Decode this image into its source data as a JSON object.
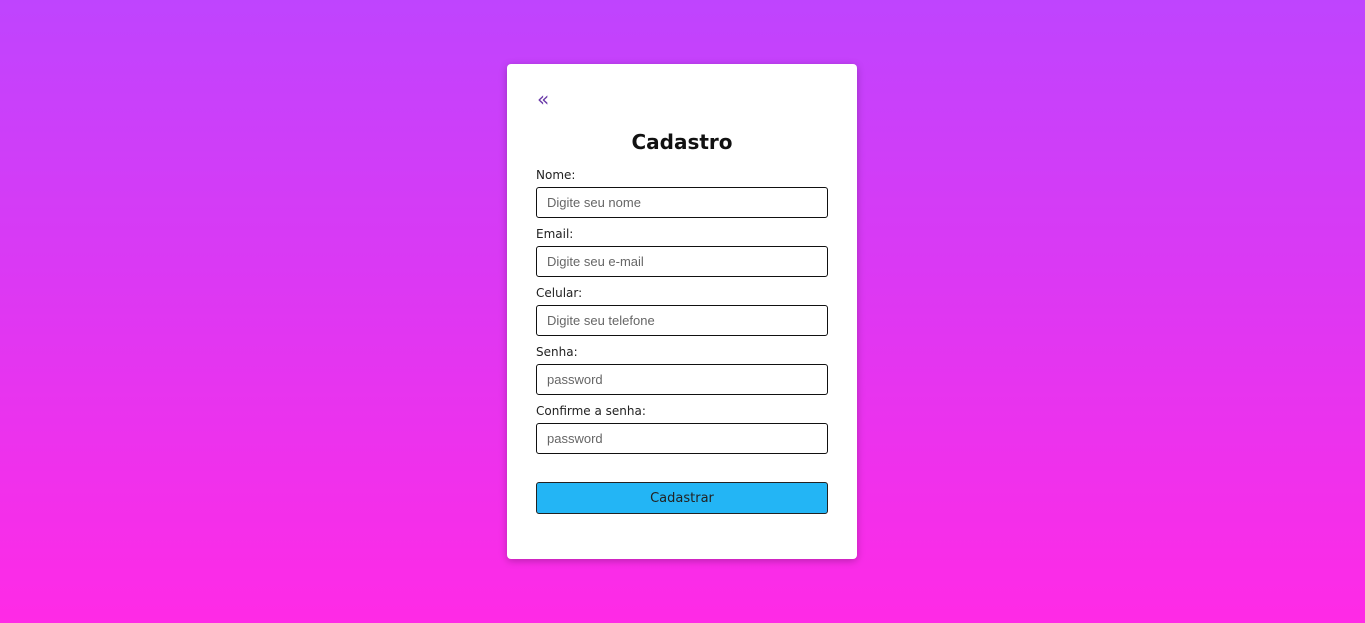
{
  "form": {
    "back_symbol": "«",
    "title": "Cadastro",
    "fields": [
      {
        "label": "Nome:",
        "placeholder": "Digite seu nome",
        "value": ""
      },
      {
        "label": "Email:",
        "placeholder": "Digite seu e-mail",
        "value": ""
      },
      {
        "label": "Celular:",
        "placeholder": "Digite seu telefone",
        "value": ""
      },
      {
        "label": "Senha:",
        "placeholder": "password",
        "value": ""
      },
      {
        "label": "Confirme a senha:",
        "placeholder": "password",
        "value": ""
      }
    ],
    "submit_label": "Cadastrar"
  },
  "colors": {
    "background_top": "#bf44fe",
    "background_bottom": "#ff2ae6",
    "button": "#23b5f5",
    "back_link": "#6a3aa8"
  },
  "icons": {
    "back": "double-chevron-left-icon"
  }
}
